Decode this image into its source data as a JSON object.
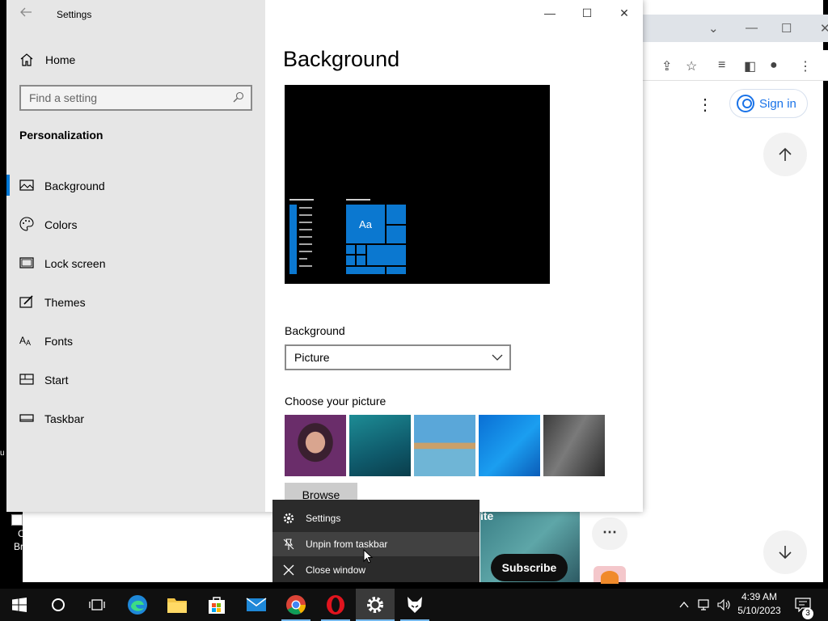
{
  "settings": {
    "window_title": "Settings",
    "home_label": "Home",
    "search_placeholder": "Find a setting",
    "section": "Personalization",
    "nav": [
      {
        "label": "Background",
        "icon": "picture-icon",
        "active": true
      },
      {
        "label": "Colors",
        "icon": "palette-icon"
      },
      {
        "label": "Lock screen",
        "icon": "lock-screen-icon"
      },
      {
        "label": "Themes",
        "icon": "themes-icon"
      },
      {
        "label": "Fonts",
        "icon": "fonts-icon"
      },
      {
        "label": "Start",
        "icon": "start-icon"
      },
      {
        "label": "Taskbar",
        "icon": "taskbar-icon"
      }
    ],
    "page_title": "Background",
    "preview_tile_text": "Aa",
    "background_label": "Background",
    "background_value": "Picture",
    "choose_label": "Choose your picture",
    "browse_label": "Browse",
    "accent_color": "#0078d7"
  },
  "browser": {
    "sign_in_label": "Sign in",
    "subscribe_label": "Subscribe",
    "thumb_text": "ite",
    "more_label": "⋯"
  },
  "context_menu": {
    "items": [
      {
        "label": "Settings",
        "icon": "gear-icon"
      },
      {
        "label": "Unpin from taskbar",
        "icon": "unpin-icon",
        "hover": true
      },
      {
        "label": "Close window",
        "icon": "close-icon"
      }
    ]
  },
  "desktop": {
    "shortcut_line1": "C",
    "shortcut_line2": "Br"
  },
  "taskbar": {
    "time": "4:39 AM",
    "date": "5/10/2023",
    "notification_count": "3"
  }
}
